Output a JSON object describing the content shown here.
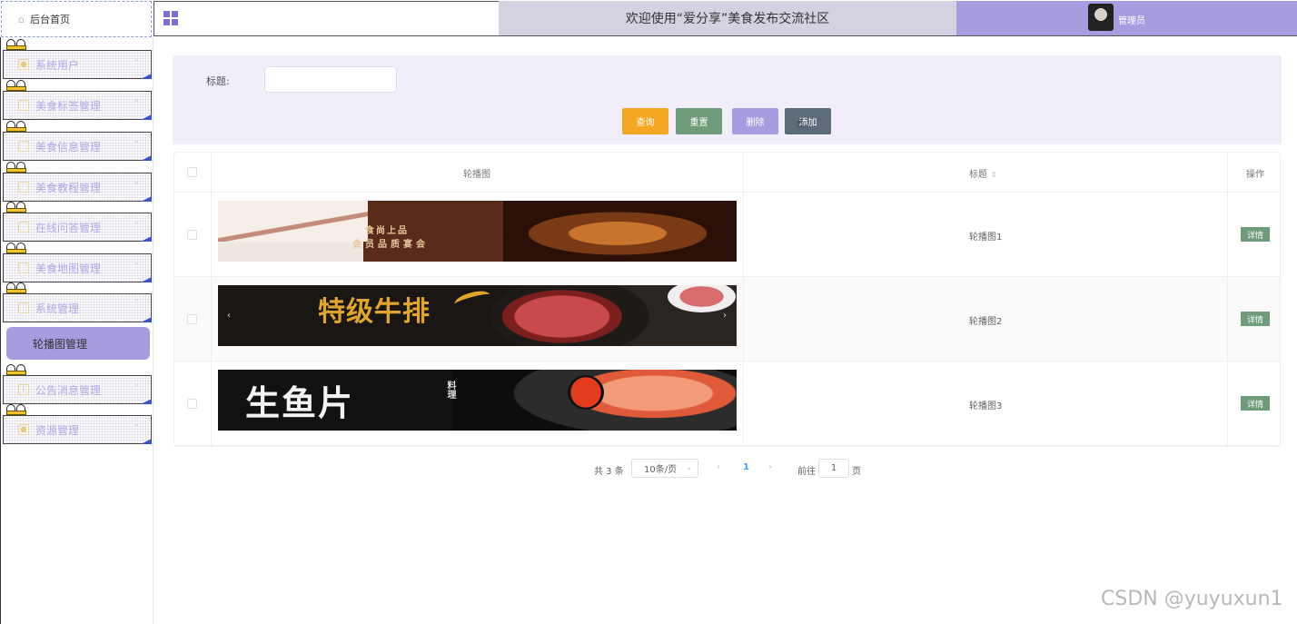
{
  "header": {
    "home_tab": "后台首页",
    "title": "欢迎使用“爱分享”美食发布交流社区",
    "user": "管理员"
  },
  "sidebar": {
    "items": [
      {
        "label": "系统用户"
      },
      {
        "label": "美食标签管理"
      },
      {
        "label": "美食信息管理"
      },
      {
        "label": "美食教程管理"
      },
      {
        "label": "在线问答管理"
      },
      {
        "label": "美食地图管理"
      },
      {
        "label": "系统管理"
      },
      {
        "label": "公告消息管理"
      },
      {
        "label": "资源管理"
      }
    ],
    "active_sub": "轮播图管理"
  },
  "search": {
    "label": "标题:",
    "value": "",
    "placeholder": "",
    "buttons": {
      "search": "查询",
      "reset": "重置",
      "delete": "删除",
      "add": "添加"
    }
  },
  "table": {
    "columns": {
      "image": "轮播图",
      "title": "标题",
      "action": "操作"
    },
    "rows": [
      {
        "title": "轮播图1",
        "banner_text": "会员品质宴会",
        "banner_sub": "食尚上品",
        "action": "详情"
      },
      {
        "title": "轮播图2",
        "banner_text": "特级牛排",
        "banner_sub": "",
        "action": "详情"
      },
      {
        "title": "轮播图3",
        "banner_text": "生鱼片",
        "banner_sub": "料理",
        "action": "详情"
      }
    ]
  },
  "pagination": {
    "total": "共 3 条",
    "page_size": "10条/页",
    "current": "1",
    "goto_label": "前往",
    "goto_value": "1",
    "page_label": "页"
  },
  "watermark": "CSDN @yuyuxun1",
  "colors": {
    "accent": "#a89ce0",
    "title_band": "#d6d1e0",
    "search_bg": "#f1eef9",
    "btn_search": "#f5a623",
    "btn_reset": "#6e9b7a",
    "btn_delete": "#a89ce0",
    "btn_add": "#5d6a78"
  }
}
